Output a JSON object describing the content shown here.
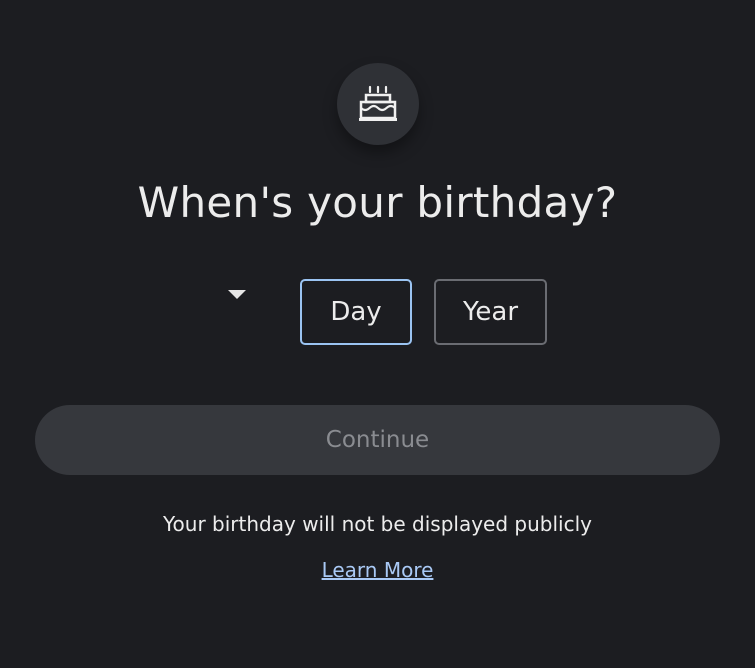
{
  "icon": "birthday-cake-icon",
  "title": "When's your birthday?",
  "month_select": {
    "value": "",
    "icon": "caret-down-icon"
  },
  "day_field": {
    "placeholder": "Day",
    "value": "",
    "focused": true
  },
  "year_field": {
    "placeholder": "Year",
    "value": ""
  },
  "continue_button": {
    "label": "Continue",
    "enabled": false
  },
  "notice": "Your birthday will not be displayed publicly",
  "learn_more": "Learn More",
  "colors": {
    "background": "#1c1d21",
    "focus_border": "#9bc4f2",
    "link": "#a9c9f5",
    "button_bg": "#36383d",
    "button_text_disabled": "#8a8c91"
  }
}
